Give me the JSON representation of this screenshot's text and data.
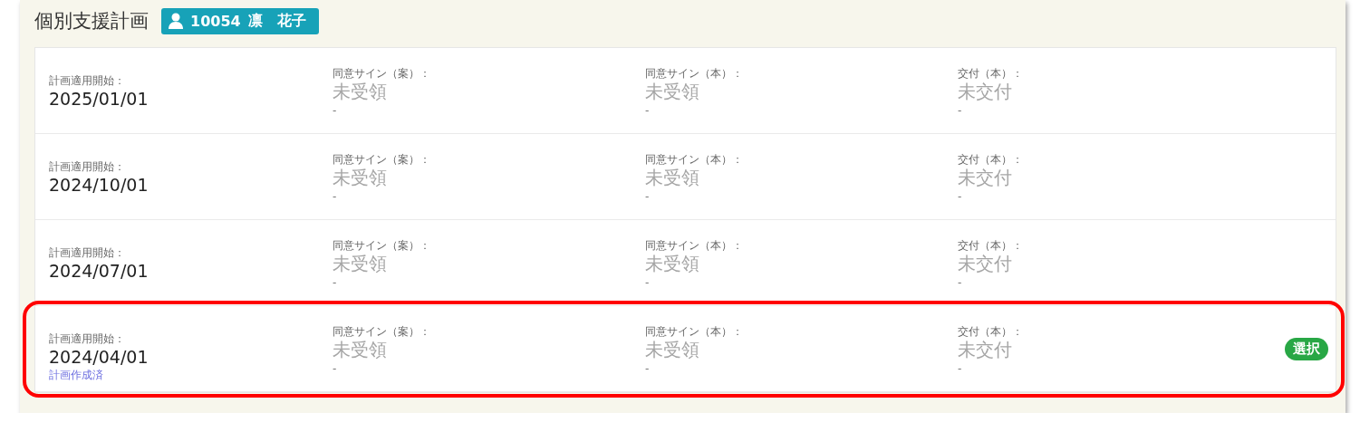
{
  "title": "個別支援計画",
  "client_badge": {
    "id": "10054",
    "name": "凛　花子"
  },
  "plans": [
    {
      "start_label": "計画適用開始：",
      "start_date": "2025/01/01",
      "highlighted": false,
      "cells": [
        {
          "label": "同意サイン（案）：",
          "value": "未受領",
          "note": "-"
        },
        {
          "label": "同意サイン（本）：",
          "value": "未受領",
          "note": "-"
        },
        {
          "label": "交付（本）：",
          "value": "未交付",
          "note": "-"
        }
      ]
    },
    {
      "start_label": "計画適用開始：",
      "start_date": "2024/10/01",
      "highlighted": false,
      "cells": [
        {
          "label": "同意サイン（案）：",
          "value": "未受領",
          "note": "-"
        },
        {
          "label": "同意サイン（本）：",
          "value": "未受領",
          "note": "-"
        },
        {
          "label": "交付（本）：",
          "value": "未交付",
          "note": "-"
        }
      ]
    },
    {
      "start_label": "計画適用開始：",
      "start_date": "2024/07/01",
      "highlighted": false,
      "cells": [
        {
          "label": "同意サイン（案）：",
          "value": "未受領",
          "note": "-"
        },
        {
          "label": "同意サイン（本）：",
          "value": "未受領",
          "note": "-"
        },
        {
          "label": "交付（本）：",
          "value": "未交付",
          "note": "-"
        }
      ]
    },
    {
      "start_label": "計画適用開始：",
      "start_date": "2024/04/01",
      "status": "計画作成済",
      "highlighted": true,
      "action": "選択",
      "cells": [
        {
          "label": "同意サイン（案）：",
          "value": "未受領",
          "note": "-"
        },
        {
          "label": "同意サイン（本）：",
          "value": "未受領",
          "note": "-"
        },
        {
          "label": "交付（本）：",
          "value": "未交付",
          "note": "-"
        }
      ]
    }
  ]
}
